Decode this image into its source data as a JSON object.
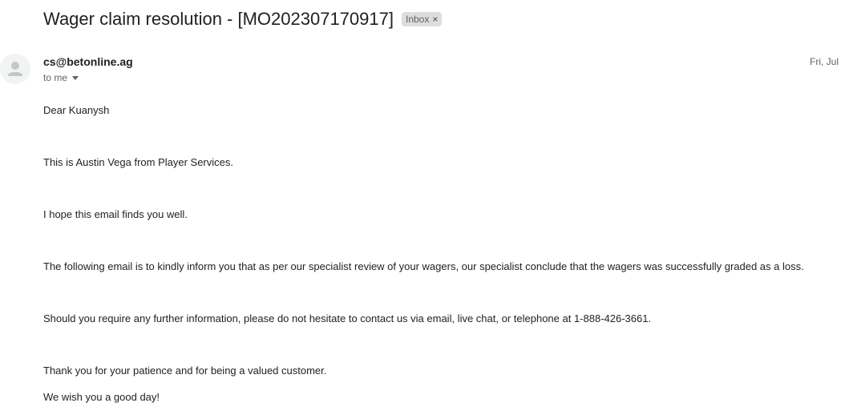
{
  "email": {
    "subject": "Wager claim resolution - [MO202307170917]",
    "label": "Inbox",
    "label_remove": "×",
    "sender": "cs@betonline.ag",
    "recipient_text": "to me",
    "date": "Fri, Jul",
    "body": [
      "Dear Kuanysh",
      "This is Austin Vega from Player Services.",
      "I hope this email finds you well.",
      "The following email is to kindly inform you that as per our specialist review of your wagers, our specialist conclude that the wagers was successfully graded as a loss.",
      "Should you require any further information, please do not hesitate to contact us via email, live chat, or telephone at 1-888-426-3661.",
      "Thank you for your patience and for being a valued customer.",
      "We wish you a good day!"
    ]
  },
  "icons": {
    "avatar": "default-person-avatar-icon",
    "recipient_caret": "caret-down-icon",
    "label_close": "close-icon"
  }
}
